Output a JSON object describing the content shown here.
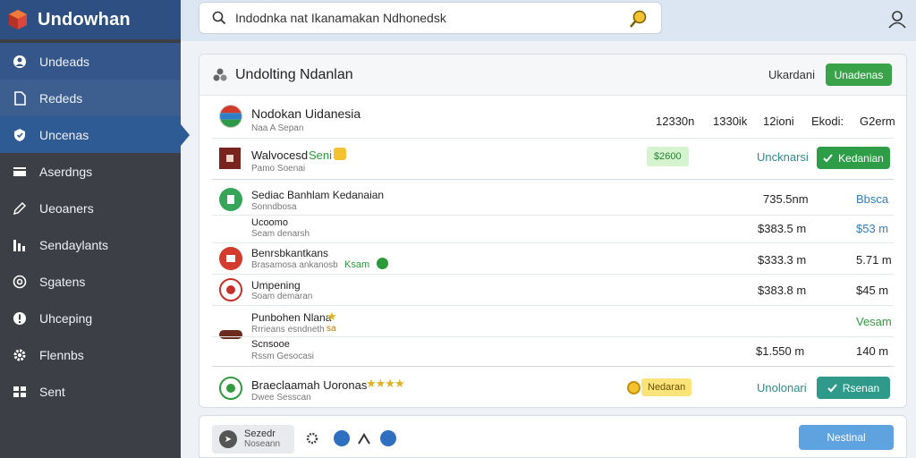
{
  "app": {
    "name": "Undowhan"
  },
  "sidebar": {
    "items": [
      {
        "label": "Undeads",
        "icon": "user-icon"
      },
      {
        "label": "Rededs",
        "icon": "document-icon"
      },
      {
        "label": "Uncenas",
        "icon": "shield-icon"
      },
      {
        "label": "Aserdngs",
        "icon": "card-icon"
      },
      {
        "label": "Ueoaners",
        "icon": "pen-icon"
      },
      {
        "label": "Sendaylants",
        "icon": "bar-chart-icon"
      },
      {
        "label": "Sgatens",
        "icon": "settings-circle-icon"
      },
      {
        "label": "Uhceping",
        "icon": "alert-icon"
      },
      {
        "label": "Flennbs",
        "icon": "gear-icon"
      },
      {
        "label": "Sent",
        "icon": "grid-icon"
      }
    ],
    "active_index": 2
  },
  "search": {
    "value": "Indodnka nat Ikanamakan Ndhonedsk"
  },
  "panel": {
    "title": "Undolting Ndanlan",
    "header_link": "Ukardani",
    "header_button": "Unadenas",
    "columns": [
      "12330n",
      "1330ik",
      "12ioni",
      "Ekodi:",
      "G2erm"
    ],
    "top_item": {
      "title": "Nodokan Uidanesia",
      "subtitle": "Naa A Sepan"
    },
    "featured": {
      "title": "Walvocesd",
      "tag": "Seni",
      "subtitle": "Pamo Soenai",
      "badge": "$2600",
      "link": "Uncknarsi",
      "button": "Kedanian"
    },
    "rows": [
      {
        "title": "Sediac Banhlam Kedanaian",
        "subtitle": "Sonndbosa",
        "amount": "735.5nm",
        "end": "Bbsca"
      },
      {
        "title": "Ucoomo",
        "subtitle": "Seam denarsh",
        "amount": "$383.5 m",
        "end": "$53 m"
      },
      {
        "title": "Benrsbkantkans",
        "subtitle": "Brasamosa ankanosb",
        "tag": "Ksam",
        "amount": "$333.3 m",
        "end": "5.71 m"
      },
      {
        "title": "Umpening",
        "subtitle": "Soam demaran",
        "amount": "$383.8 m",
        "end": "$45 m"
      },
      {
        "title": "Punbohen Nlana",
        "subtitle": "Rrrieans esndneth",
        "tag": "sa",
        "amount": "",
        "end": "Vesam"
      },
      {
        "title": "Scnsooe",
        "subtitle": "Rssm Gesocasi",
        "amount": "$1.550 m",
        "end": "140 m"
      }
    ],
    "last": {
      "title": "Braeclaamah Uoronas",
      "subtitle": "Dwee Sesscan",
      "badge": "Nedaran",
      "link": "Unolonari",
      "button": "Rsenan"
    }
  },
  "footer": {
    "pill_line1": "Sezedr",
    "pill_line2": "Noseann",
    "button": "Nestinal"
  },
  "colors": {
    "sidebar": "#3c3f45",
    "brand": "#2d4f82",
    "active": "#2f5b95",
    "accent_green": "#3aa34a"
  }
}
